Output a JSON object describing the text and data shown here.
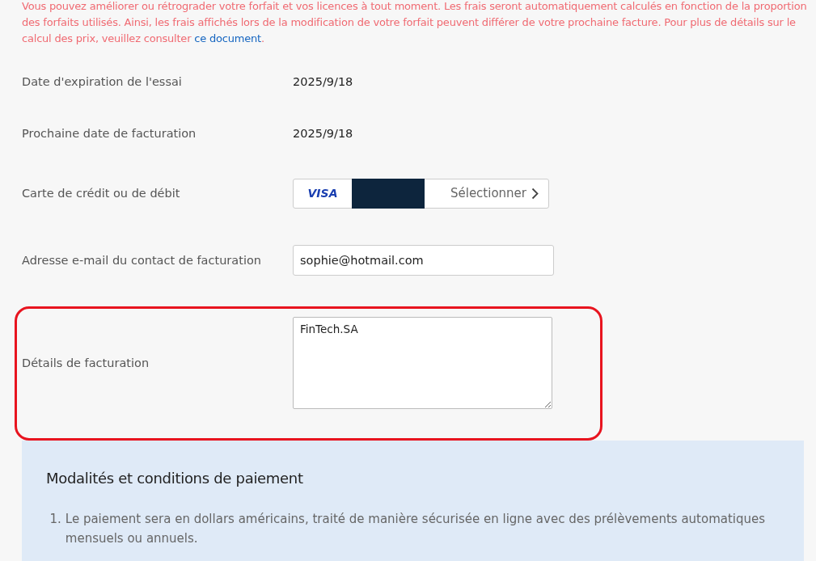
{
  "notice": {
    "text": "Vous pouvez améliorer ou rétrograder votre forfait et vos licences à tout moment. Les frais seront automatiquement calculés en fonction de la proportion des forfaits utilisés. Ainsi, les frais affichés lors de la modification de votre forfait peuvent différer de votre prochaine facture. Pour plus de détails sur le calcul des prix, veuillez consulter",
    "link": "ce document",
    "after": "."
  },
  "fields": [
    {
      "kind": "text",
      "label": "Date d'expiration de l'essai",
      "value": "2025/9/18",
      "highlighted": false
    },
    {
      "kind": "text",
      "label": "Prochaine date de facturation",
      "value": "2025/9/18",
      "highlighted": false
    },
    {
      "kind": "card",
      "label": "Carte de crédit ou de débit",
      "brand": "VISA",
      "masked": true,
      "action": "Sélectionner",
      "highlighted": false
    },
    {
      "kind": "input",
      "label": "Adresse e-mail du contact de facturation",
      "value": "sophie@hotmail.com",
      "highlighted": false
    },
    {
      "kind": "textarea",
      "label": "Détails de facturation",
      "value": "FinTech.SA",
      "highlighted": true
    }
  ],
  "terms": {
    "title": "Modalités et conditions de paiement",
    "items": [
      {
        "number": "1.",
        "text": "Le paiement sera en dollars américains, traité de manière sécurisée en ligne avec des prélèvements automatiques mensuels ou annuels."
      }
    ]
  }
}
